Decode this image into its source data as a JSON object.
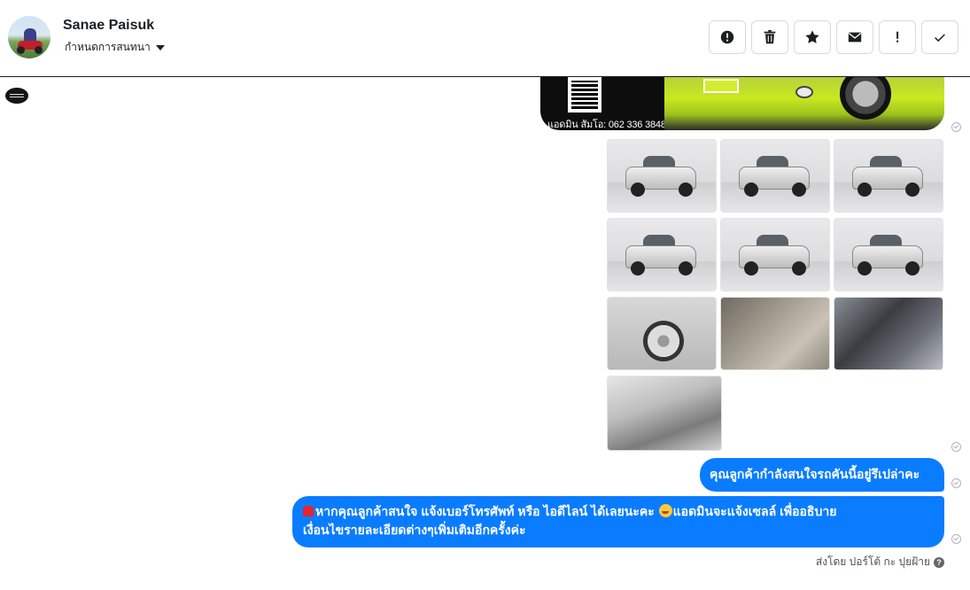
{
  "header": {
    "contact_name": "Sanae Paisuk",
    "assign_label": "กำหนดการสนทนา",
    "actions": [
      {
        "name": "mark-spam-button",
        "icon": "alert-circle-icon"
      },
      {
        "name": "delete-button",
        "icon": "trash-icon"
      },
      {
        "name": "star-button",
        "icon": "star-icon"
      },
      {
        "name": "mark-unread-button",
        "icon": "envelope-icon"
      },
      {
        "name": "follow-up-button",
        "icon": "exclamation-icon"
      },
      {
        "name": "mark-done-button",
        "icon": "check-icon"
      }
    ]
  },
  "banner": {
    "contact_text": "แอดมิน สัมโอ: 062 336 3848"
  },
  "photos": {
    "count": 10,
    "subjects": [
      "truck-front-left",
      "truck-front",
      "truck-rear-right",
      "truck-rear",
      "truck-side-left",
      "truck-side-right",
      "wheel",
      "gear-stick",
      "engine-bay",
      "front-seat"
    ]
  },
  "messages": [
    {
      "text": "คุณลูกค้ากำลังสนใจรถคันนี้อยู่รึเปล่าคะ"
    },
    {
      "text_part1": "หากคุณลูกค้าสนใจ แจ้งเบอร์โทรศัพท์ หรือ ไอดีไลน์  ได้เลยนะคะ",
      "text_part2": "แอดมินจะแจ้งเซลล์   เพื่ออธิบาย",
      "text_part3": "เงื่อนไขรายละเอียดต่างๆเพิ่มเติมอีกครั้งค่ะ"
    }
  ],
  "footer": {
    "sent_by": "ส่งโดย ปอร์โต้ กะ ปุยฝ้าย"
  },
  "colors": {
    "bubble": "#0a7cff",
    "banner_accent": "#c8e81f"
  }
}
